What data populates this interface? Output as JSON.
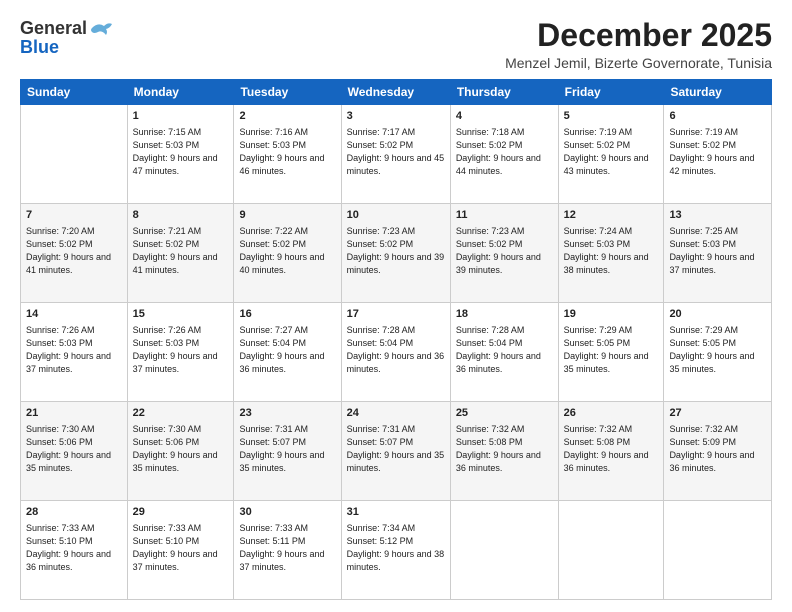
{
  "header": {
    "logo_general": "General",
    "logo_blue": "Blue",
    "month_title": "December 2025",
    "location": "Menzel Jemil, Bizerte Governorate, Tunisia"
  },
  "days_of_week": [
    "Sunday",
    "Monday",
    "Tuesday",
    "Wednesday",
    "Thursday",
    "Friday",
    "Saturday"
  ],
  "weeks": [
    [
      {
        "day": "",
        "sunrise": "",
        "sunset": "",
        "daylight": ""
      },
      {
        "day": "1",
        "sunrise": "Sunrise: 7:15 AM",
        "sunset": "Sunset: 5:03 PM",
        "daylight": "Daylight: 9 hours and 47 minutes."
      },
      {
        "day": "2",
        "sunrise": "Sunrise: 7:16 AM",
        "sunset": "Sunset: 5:03 PM",
        "daylight": "Daylight: 9 hours and 46 minutes."
      },
      {
        "day": "3",
        "sunrise": "Sunrise: 7:17 AM",
        "sunset": "Sunset: 5:02 PM",
        "daylight": "Daylight: 9 hours and 45 minutes."
      },
      {
        "day": "4",
        "sunrise": "Sunrise: 7:18 AM",
        "sunset": "Sunset: 5:02 PM",
        "daylight": "Daylight: 9 hours and 44 minutes."
      },
      {
        "day": "5",
        "sunrise": "Sunrise: 7:19 AM",
        "sunset": "Sunset: 5:02 PM",
        "daylight": "Daylight: 9 hours and 43 minutes."
      },
      {
        "day": "6",
        "sunrise": "Sunrise: 7:19 AM",
        "sunset": "Sunset: 5:02 PM",
        "daylight": "Daylight: 9 hours and 42 minutes."
      }
    ],
    [
      {
        "day": "7",
        "sunrise": "Sunrise: 7:20 AM",
        "sunset": "Sunset: 5:02 PM",
        "daylight": "Daylight: 9 hours and 41 minutes."
      },
      {
        "day": "8",
        "sunrise": "Sunrise: 7:21 AM",
        "sunset": "Sunset: 5:02 PM",
        "daylight": "Daylight: 9 hours and 41 minutes."
      },
      {
        "day": "9",
        "sunrise": "Sunrise: 7:22 AM",
        "sunset": "Sunset: 5:02 PM",
        "daylight": "Daylight: 9 hours and 40 minutes."
      },
      {
        "day": "10",
        "sunrise": "Sunrise: 7:23 AM",
        "sunset": "Sunset: 5:02 PM",
        "daylight": "Daylight: 9 hours and 39 minutes."
      },
      {
        "day": "11",
        "sunrise": "Sunrise: 7:23 AM",
        "sunset": "Sunset: 5:02 PM",
        "daylight": "Daylight: 9 hours and 39 minutes."
      },
      {
        "day": "12",
        "sunrise": "Sunrise: 7:24 AM",
        "sunset": "Sunset: 5:03 PM",
        "daylight": "Daylight: 9 hours and 38 minutes."
      },
      {
        "day": "13",
        "sunrise": "Sunrise: 7:25 AM",
        "sunset": "Sunset: 5:03 PM",
        "daylight": "Daylight: 9 hours and 37 minutes."
      }
    ],
    [
      {
        "day": "14",
        "sunrise": "Sunrise: 7:26 AM",
        "sunset": "Sunset: 5:03 PM",
        "daylight": "Daylight: 9 hours and 37 minutes."
      },
      {
        "day": "15",
        "sunrise": "Sunrise: 7:26 AM",
        "sunset": "Sunset: 5:03 PM",
        "daylight": "Daylight: 9 hours and 37 minutes."
      },
      {
        "day": "16",
        "sunrise": "Sunrise: 7:27 AM",
        "sunset": "Sunset: 5:04 PM",
        "daylight": "Daylight: 9 hours and 36 minutes."
      },
      {
        "day": "17",
        "sunrise": "Sunrise: 7:28 AM",
        "sunset": "Sunset: 5:04 PM",
        "daylight": "Daylight: 9 hours and 36 minutes."
      },
      {
        "day": "18",
        "sunrise": "Sunrise: 7:28 AM",
        "sunset": "Sunset: 5:04 PM",
        "daylight": "Daylight: 9 hours and 36 minutes."
      },
      {
        "day": "19",
        "sunrise": "Sunrise: 7:29 AM",
        "sunset": "Sunset: 5:05 PM",
        "daylight": "Daylight: 9 hours and 35 minutes."
      },
      {
        "day": "20",
        "sunrise": "Sunrise: 7:29 AM",
        "sunset": "Sunset: 5:05 PM",
        "daylight": "Daylight: 9 hours and 35 minutes."
      }
    ],
    [
      {
        "day": "21",
        "sunrise": "Sunrise: 7:30 AM",
        "sunset": "Sunset: 5:06 PM",
        "daylight": "Daylight: 9 hours and 35 minutes."
      },
      {
        "day": "22",
        "sunrise": "Sunrise: 7:30 AM",
        "sunset": "Sunset: 5:06 PM",
        "daylight": "Daylight: 9 hours and 35 minutes."
      },
      {
        "day": "23",
        "sunrise": "Sunrise: 7:31 AM",
        "sunset": "Sunset: 5:07 PM",
        "daylight": "Daylight: 9 hours and 35 minutes."
      },
      {
        "day": "24",
        "sunrise": "Sunrise: 7:31 AM",
        "sunset": "Sunset: 5:07 PM",
        "daylight": "Daylight: 9 hours and 35 minutes."
      },
      {
        "day": "25",
        "sunrise": "Sunrise: 7:32 AM",
        "sunset": "Sunset: 5:08 PM",
        "daylight": "Daylight: 9 hours and 36 minutes."
      },
      {
        "day": "26",
        "sunrise": "Sunrise: 7:32 AM",
        "sunset": "Sunset: 5:08 PM",
        "daylight": "Daylight: 9 hours and 36 minutes."
      },
      {
        "day": "27",
        "sunrise": "Sunrise: 7:32 AM",
        "sunset": "Sunset: 5:09 PM",
        "daylight": "Daylight: 9 hours and 36 minutes."
      }
    ],
    [
      {
        "day": "28",
        "sunrise": "Sunrise: 7:33 AM",
        "sunset": "Sunset: 5:10 PM",
        "daylight": "Daylight: 9 hours and 36 minutes."
      },
      {
        "day": "29",
        "sunrise": "Sunrise: 7:33 AM",
        "sunset": "Sunset: 5:10 PM",
        "daylight": "Daylight: 9 hours and 37 minutes."
      },
      {
        "day": "30",
        "sunrise": "Sunrise: 7:33 AM",
        "sunset": "Sunset: 5:11 PM",
        "daylight": "Daylight: 9 hours and 37 minutes."
      },
      {
        "day": "31",
        "sunrise": "Sunrise: 7:34 AM",
        "sunset": "Sunset: 5:12 PM",
        "daylight": "Daylight: 9 hours and 38 minutes."
      },
      {
        "day": "",
        "sunrise": "",
        "sunset": "",
        "daylight": ""
      },
      {
        "day": "",
        "sunrise": "",
        "sunset": "",
        "daylight": ""
      },
      {
        "day": "",
        "sunrise": "",
        "sunset": "",
        "daylight": ""
      }
    ]
  ]
}
